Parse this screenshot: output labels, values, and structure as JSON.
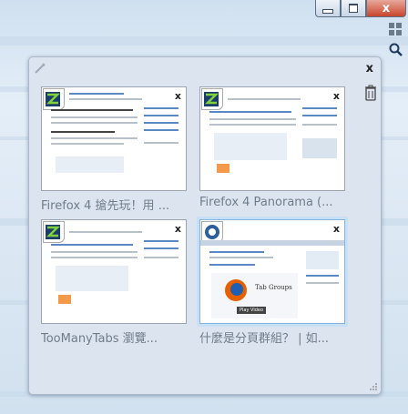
{
  "window": {
    "minimize_icon": "minimize-icon",
    "restore_icon": "restore-icon",
    "close_label": "x"
  },
  "side_tools": {
    "groups_icon": "tab-groups-icon",
    "search_icon": "search-icon"
  },
  "group": {
    "close_label": "x",
    "tabs": [
      {
        "title": "Firefox 4 搶先玩！用 ...",
        "close": "x"
      },
      {
        "title": "Firefox 4 Panorama (...",
        "close": "x"
      },
      {
        "title": "TooManyTabs 瀏覽...",
        "close": "x"
      },
      {
        "title": "什麼是分頁群組？ | 如...",
        "close": "x",
        "thumb_caption": "Tab Groups",
        "thumb_button": "Play Video"
      }
    ]
  },
  "colors": {
    "accent": "#87b5dd",
    "panel": "#dbe4ef",
    "close_red": "#c8452c"
  }
}
